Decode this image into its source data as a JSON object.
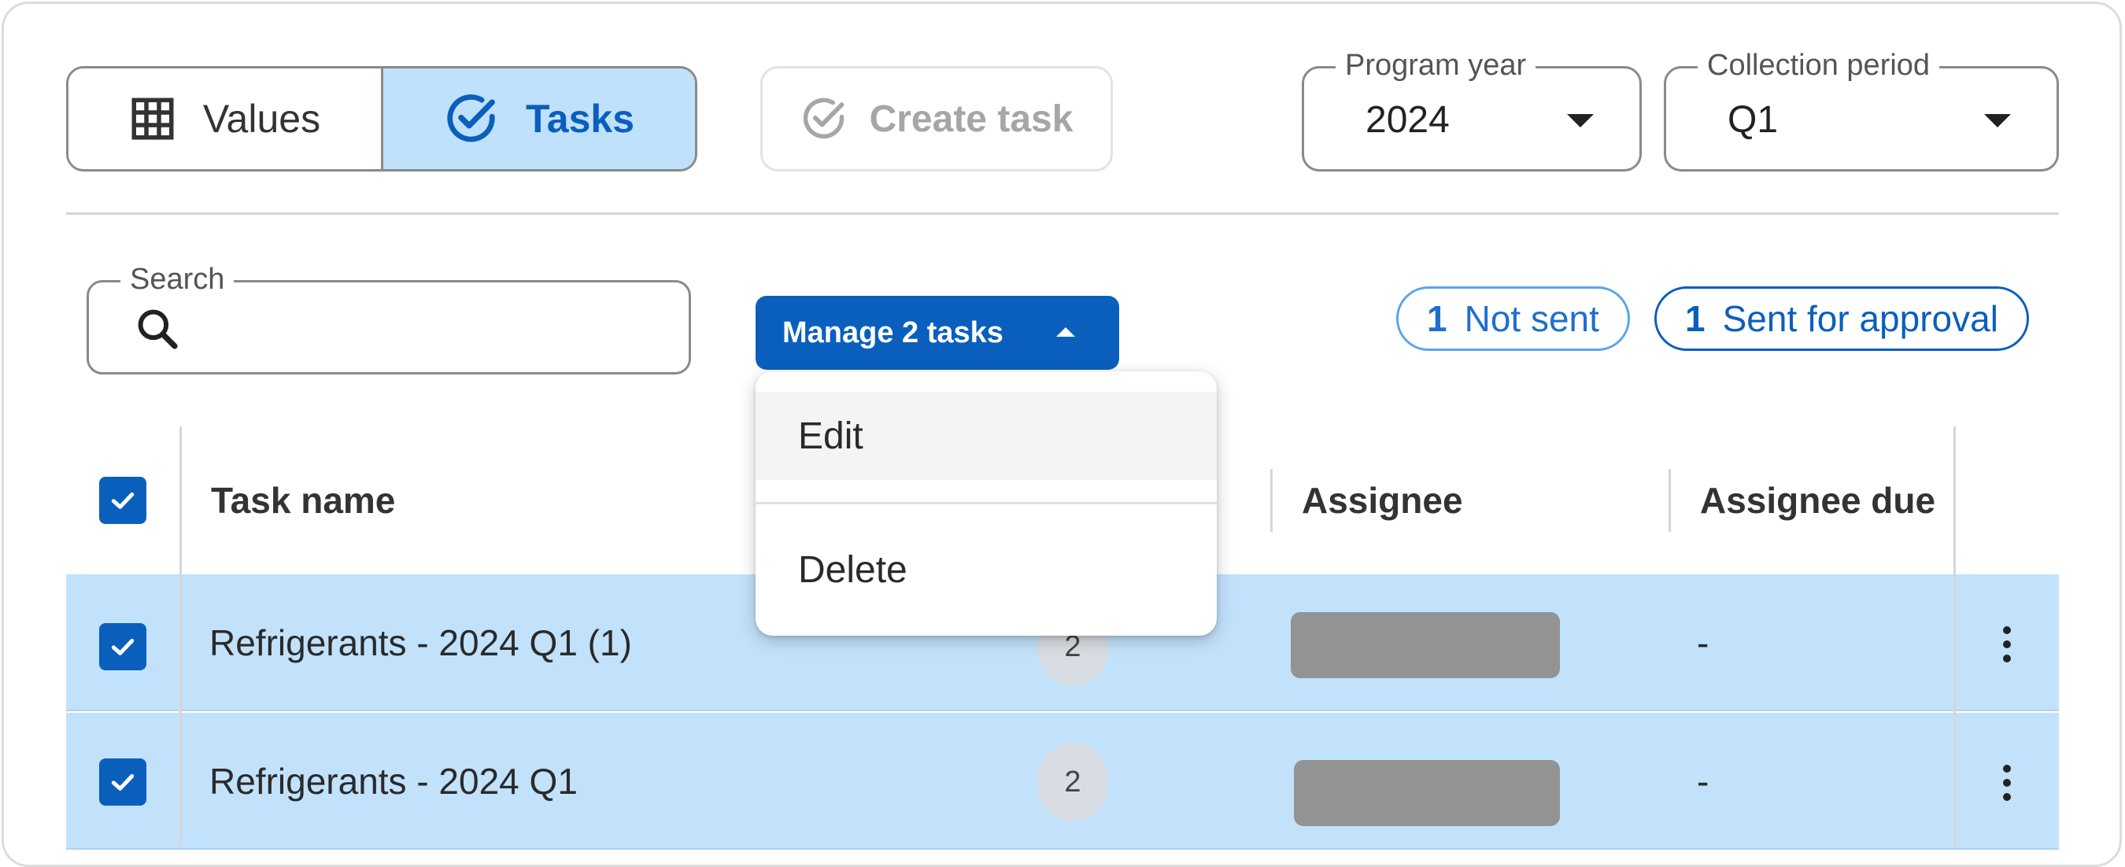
{
  "view_toggle": {
    "values_label": "Values",
    "tasks_label": "Tasks",
    "selected": "Tasks"
  },
  "create_task": {
    "label": "Create task",
    "disabled": true
  },
  "program_year": {
    "label": "Program year",
    "value": "2024"
  },
  "collection_period": {
    "label": "Collection period",
    "value": "Q1"
  },
  "search": {
    "label": "Search",
    "value": ""
  },
  "manage": {
    "label": "Manage 2 tasks",
    "menu": [
      {
        "label": "Edit"
      },
      {
        "label": "Delete"
      }
    ]
  },
  "status_chips": [
    {
      "count": "1",
      "label": "Not sent"
    },
    {
      "count": "1",
      "label": "Sent for approval"
    }
  ],
  "table": {
    "columns": [
      "Task name",
      "Assignee",
      "Assignee due"
    ],
    "select_all_checked": true,
    "rows": [
      {
        "checked": true,
        "task_name": "Refrigerants - 2024 Q1 (1)",
        "count": "2",
        "assignee": "",
        "assignee_due": "-"
      },
      {
        "checked": true,
        "task_name": "Refrigerants - 2024 Q1",
        "count": "2",
        "assignee": "",
        "assignee_due": "-"
      }
    ]
  },
  "colors": {
    "primary": "#0a5fbd",
    "selected_row": "#c2e2fc",
    "selected_toggle": "#bfe1fc",
    "chip_light": "#5aa6ea"
  },
  "icons": {
    "values": "grid-icon",
    "tasks": "check-circle-icon",
    "create": "check-circle-icon",
    "search": "search-icon",
    "select": "caret-down-icon",
    "manage": "caret-up-icon",
    "row_menu": "kebab-icon"
  }
}
